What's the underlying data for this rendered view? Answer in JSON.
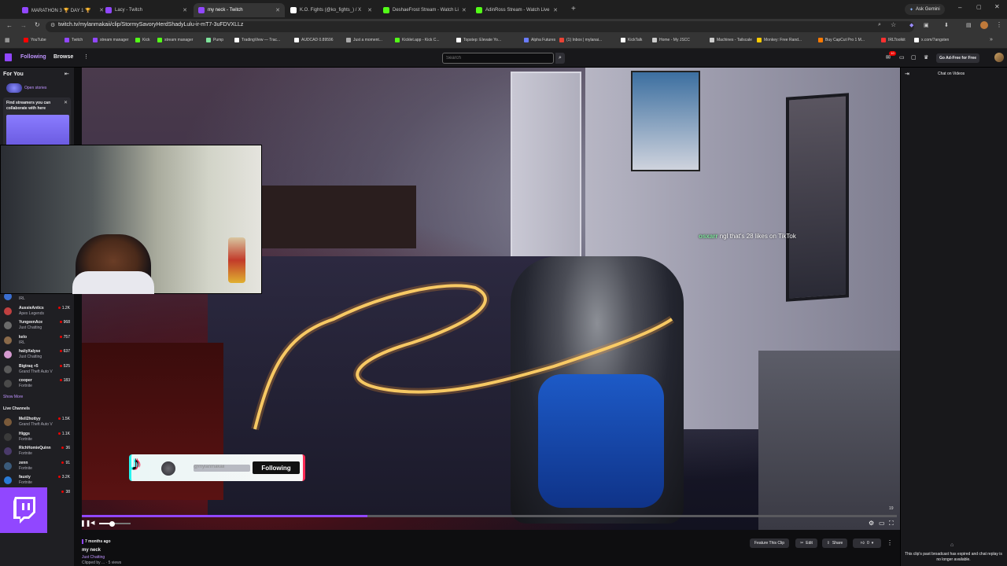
{
  "browser": {
    "tabs": [
      {
        "label": "MARATHON 3 🏆 DAY 1 🏆",
        "color": "#9147ff"
      },
      {
        "label": "Lacy - Twitch",
        "color": "#9147ff"
      },
      {
        "label": "my neck - Twitch",
        "color": "#9147ff",
        "active": true
      },
      {
        "label": "K.O. Fights (@ko_fights_) / X",
        "color": "#ffffff"
      },
      {
        "label": "DeshaeFrost Stream - Watch Li",
        "color": "#53fc18"
      },
      {
        "label": "AdinRoss Stream - Watch Live",
        "color": "#53fc18"
      }
    ],
    "ask_gemini": "Ask Gemini",
    "url": "twitch.tv/mylanmakaii/clip/StormySavoryHerdShadyLulu-ir-mT7-3uFDVXLLz",
    "bookmarks": [
      {
        "label": "YouTube",
        "color": "#ff0000"
      },
      {
        "label": "Twitch",
        "color": "#9147ff"
      },
      {
        "label": "stream manager",
        "color": "#9147ff"
      },
      {
        "label": "Kick",
        "color": "#53fc18"
      },
      {
        "label": "stream manager",
        "color": "#53fc18"
      },
      {
        "label": "Pump",
        "color": "#7ee39b"
      },
      {
        "label": "TradingView — Trac...",
        "color": "#ffffff"
      },
      {
        "label": "AUDCAD 0.89596",
        "color": "#ffffff"
      },
      {
        "label": "Just a moment...",
        "color": "#aaaaaa"
      },
      {
        "label": "Kicklet.app - Kick C...",
        "color": "#53fc18"
      },
      {
        "label": "Topstep: Elevate Yo...",
        "color": "#ffffff"
      },
      {
        "label": "Alpha Futures",
        "color": "#6a7cff"
      },
      {
        "label": "(1) Inbox | mylanai...",
        "color": "#ea4335"
      },
      {
        "label": "KickTalk",
        "color": "#ffffff"
      },
      {
        "label": "Home - My JSCC",
        "color": "#cccccc"
      },
      {
        "label": "Machines - Tailscale",
        "color": "#cccccc"
      },
      {
        "label": "Monkey: Free Rand...",
        "color": "#ffcc00"
      },
      {
        "label": "Buy CapCut Pro 1 M...",
        "color": "#ff7a00"
      },
      {
        "label": "IRLToolkit",
        "color": "#ff3030"
      },
      {
        "label": "x.com/7angsten",
        "color": "#ffffff"
      }
    ]
  },
  "twitch": {
    "nav": {
      "following": "Following",
      "browse": "Browse",
      "search_placeholder": "Search",
      "ad_free": "Go Ad-Free for Free",
      "notif_count": "10"
    },
    "sidebar": {
      "for_you": "For You",
      "open_stories": "Open stories",
      "collab_title": "Find streamers you can collaborate with here",
      "channels_top": [
        {
          "name": "...",
          "game": "IRL",
          "viewers": "1.2K",
          "color": "#3b6fd1"
        },
        {
          "name": "AussieAntics",
          "game": "Apex Legends",
          "viewers": "1.2K",
          "color": "#c04040"
        },
        {
          "name": "YungeenAce",
          "game": "Just Chatting",
          "viewers": "968",
          "color": "#6b6b6b"
        },
        {
          "name": "kelo",
          "game": "IRL",
          "viewers": "757",
          "color": "#8a6a4a"
        },
        {
          "name": "haiiyXalyse",
          "game": "Just Chatting",
          "viewers": "637",
          "color": "#d59ad0"
        },
        {
          "name": "Bigtraq +5",
          "game": "Grand Theft Auto V",
          "viewers": "525",
          "color": "#5a5a5a"
        },
        {
          "name": "cooper",
          "game": "Fortnite",
          "viewers": "183",
          "color": "#4a4a4a"
        }
      ],
      "show_more": "Show More",
      "live_channels": "Live Channels",
      "channels_live": [
        {
          "name": "Mell2hottyy",
          "game": "Grand Theft Auto V",
          "viewers": "1.5K",
          "color": "#7a5a3a"
        },
        {
          "name": "Higgs",
          "game": "Fortnite",
          "viewers": "1.1K",
          "color": "#3a3a3a"
        },
        {
          "name": "RichHomieQuinn",
          "game": "Fortnite",
          "viewers": "36",
          "color": "#4a3a6a"
        },
        {
          "name": "zenn",
          "game": "Fortnite",
          "viewers": "91",
          "color": "#3a5a7a"
        },
        {
          "name": "fauxty",
          "game": "Fortnite",
          "viewers": "3.2K",
          "color": "#2a7ad5"
        },
        {
          "name": "",
          "game": "",
          "viewers": "38",
          "color": "#6a3ad5"
        }
      ]
    },
    "video": {
      "chat_user": "osxarr",
      "chat_text": "ngl that's 28 likes on TikTok",
      "follow_label": "Following",
      "handle": "@mylanmakaii",
      "progress": 0.35,
      "corner_number": "19"
    },
    "clip": {
      "age": "7 months ago",
      "title": "my neck",
      "category": "Just Chatting",
      "clipped_by": "Clipped by ... · 5 views"
    },
    "actions": {
      "feature": "Feature This Clip",
      "edit": "Edit",
      "share": "Share",
      "likes": "0"
    },
    "chat_panel": {
      "title": "Chat on Videos",
      "expired": "This clip's past broadcast has expired and chat replay is no longer available."
    },
    "colors": {
      "purple": "#9147ff",
      "live_red": "#eb0400"
    }
  }
}
